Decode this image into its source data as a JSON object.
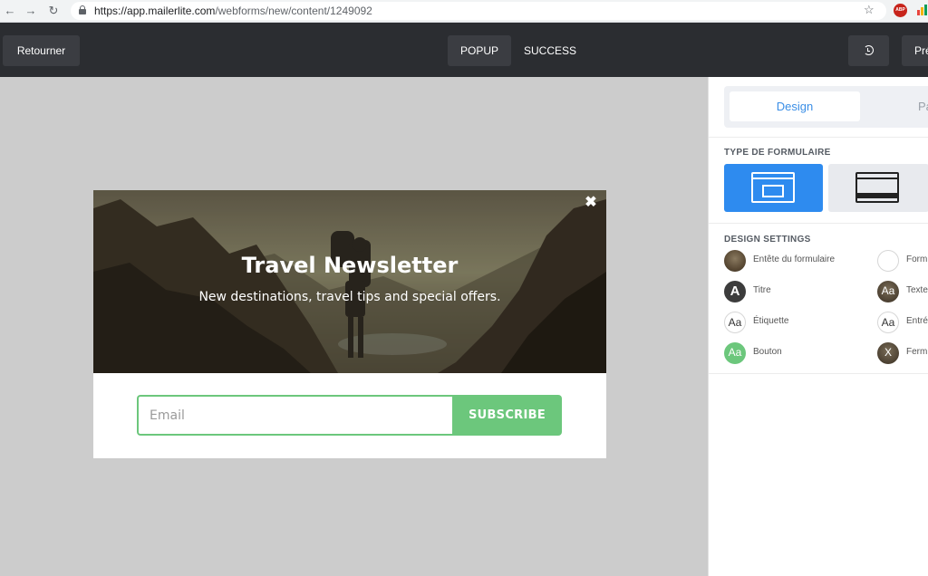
{
  "browser": {
    "url_prefix": "https://app.",
    "url_host": "mailerlite.com",
    "url_path": "/webforms/new/content/1249092",
    "ext_abp_label": "ABP"
  },
  "toolbar": {
    "back_label": "Retourner",
    "tab_popup": "POPUP",
    "tab_success": "SUCCESS",
    "preview_label": "Pré"
  },
  "popup": {
    "title": "Travel Newsletter",
    "subtitle": "New destinations, travel tips and special offers.",
    "close_glyph": "✖",
    "email_placeholder": "Email",
    "email_value": "",
    "subscribe_label": "SUBSCRIBE",
    "accent_color": "#6cc77c"
  },
  "panel": {
    "tab_design": "Design",
    "tab_other_partial": "Pa",
    "type_section_title": "TYPE DE FORMULAIRE",
    "design_section_title": "DESIGN SETTINGS",
    "settings_left": [
      {
        "label": "Entête du formulaire",
        "icon": "image-icon",
        "glyph": ""
      },
      {
        "label": "Titre",
        "icon": "title-font-icon",
        "glyph": "A"
      },
      {
        "label": "Étiquette",
        "icon": "label-font-icon",
        "glyph": "Aa"
      },
      {
        "label": "Bouton",
        "icon": "button-style-icon",
        "glyph": "Aa"
      }
    ],
    "settings_right": [
      {
        "label": "Form",
        "icon": "form-background-icon",
        "glyph": ""
      },
      {
        "label": "Texte",
        "icon": "text-font-icon",
        "glyph": "Aa"
      },
      {
        "label": "Entré",
        "icon": "input-font-icon",
        "glyph": "Aa"
      },
      {
        "label": "Ferm",
        "icon": "close-button-icon",
        "glyph": "X"
      }
    ],
    "accent_color": "#2e8bef"
  }
}
